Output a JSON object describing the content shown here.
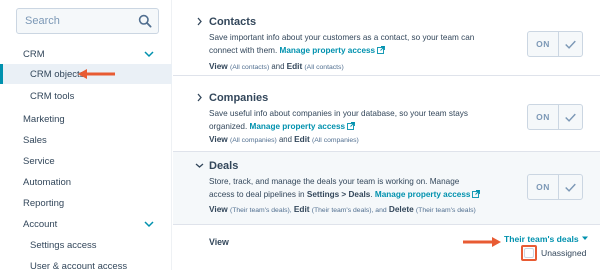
{
  "sidebar": {
    "search": {
      "placeholder": "Search",
      "icon": "search-icon"
    },
    "items": [
      {
        "label": "CRM",
        "level": 0,
        "expandable": true
      },
      {
        "label": "CRM objects",
        "level": 1,
        "active": true
      },
      {
        "label": "CRM tools",
        "level": 1
      },
      {
        "label": "Marketing",
        "level": 0
      },
      {
        "label": "Sales",
        "level": 0
      },
      {
        "label": "Service",
        "level": 0
      },
      {
        "label": "Automation",
        "level": 0
      },
      {
        "label": "Reporting",
        "level": 0
      },
      {
        "label": "Account",
        "level": 0,
        "expandable": true
      },
      {
        "label": "Settings access",
        "level": 1
      },
      {
        "label": "User & account access",
        "level": 1
      }
    ]
  },
  "main": {
    "sections": [
      {
        "title": "Contacts",
        "desc_line1": "Save important info about your customers as a contact, so your team can",
        "desc_line2_pre": "connect with them. ",
        "link": "Manage property access",
        "perm": {
          "view": "View",
          "view_scope": "(All contacts)",
          "and": "and",
          "edit": "Edit",
          "edit_scope": "(All contacts)"
        },
        "toggle": "ON"
      },
      {
        "title": "Companies",
        "desc_line1": "Save useful info about companies in your database, so your team stays",
        "desc_line2_pre": "organized. ",
        "link": "Manage property access",
        "perm": {
          "view": "View",
          "view_scope": "(All companies)",
          "and": "and",
          "edit": "Edit",
          "edit_scope": "(All companies)"
        },
        "toggle": "ON"
      },
      {
        "title": "Deals",
        "desc_line1": "Store, track, and manage the deals your team is working on. Manage",
        "desc_line2_pre": "access to deal pipelines in ",
        "desc_line2_bold": "Settings > Deals",
        "desc_line2_post": ". ",
        "link": "Manage property access",
        "perm": {
          "view": "View",
          "view_scope": "(Their team's deals),",
          "edit": "Edit",
          "edit_scope": "(Their team's deals), and",
          "delete": "Delete",
          "delete_scope": "(Their team's deals)"
        },
        "toggle": "ON"
      }
    ],
    "view_row": {
      "label": "View",
      "dropdown": "Their team's deals",
      "checkbox_label": "Unassigned"
    }
  },
  "colors": {
    "accent": "#0091ae",
    "annotation": "#e85b33",
    "text": "#33475b"
  }
}
